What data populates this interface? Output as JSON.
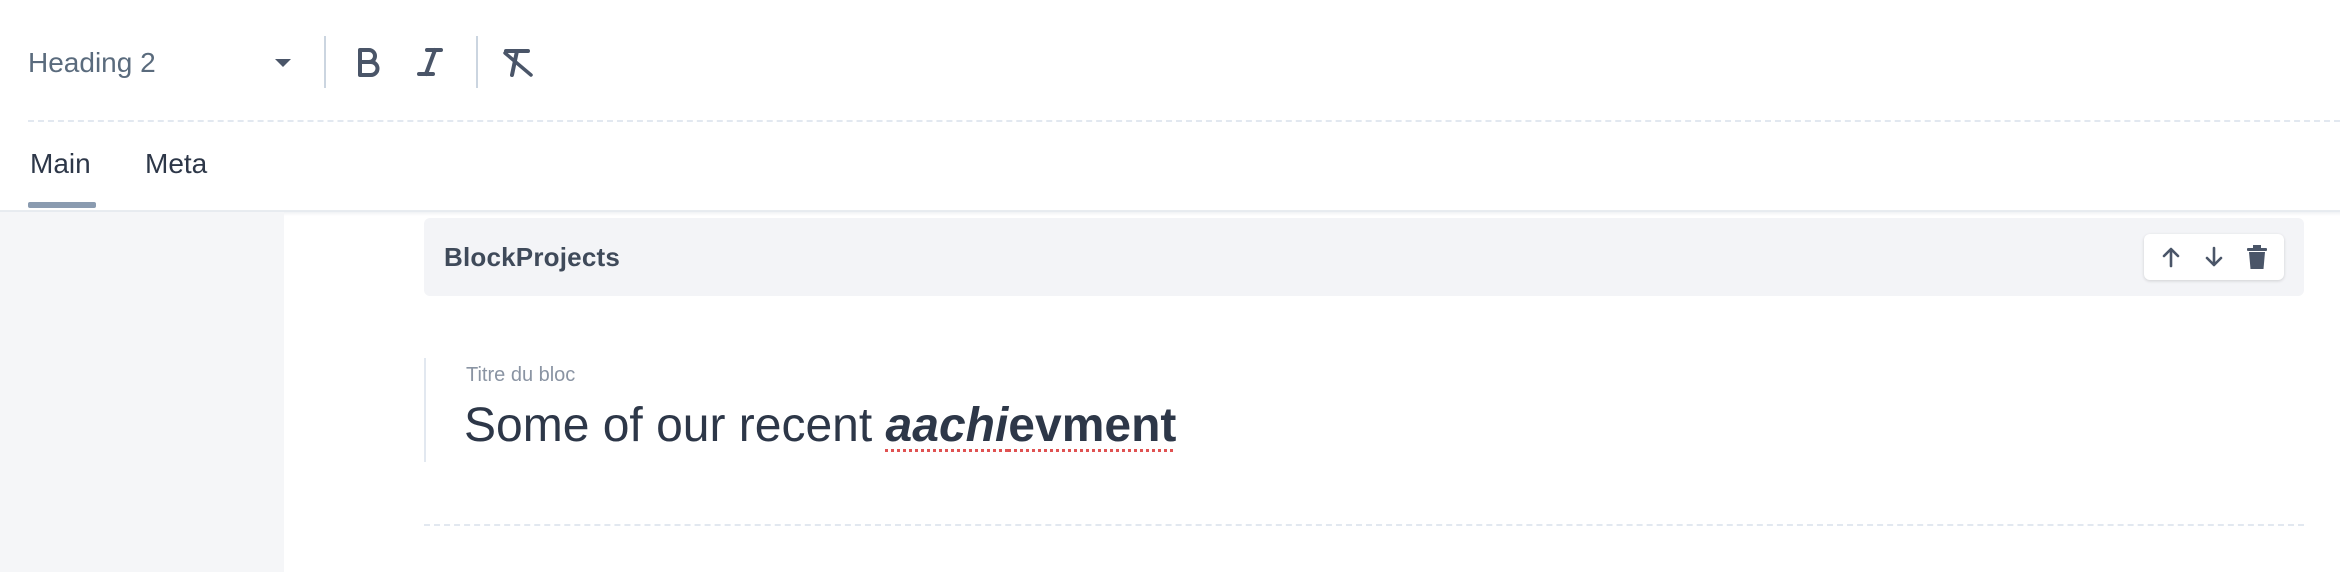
{
  "toolbar": {
    "format": "Heading 2",
    "icons": {
      "format_caret": "chevron-down-icon",
      "bold": "bold-icon",
      "italic": "italic-icon",
      "clear": "clear-format-icon"
    }
  },
  "tabs": [
    {
      "label": "Main",
      "active": true
    },
    {
      "label": "Meta",
      "active": false
    }
  ],
  "block": {
    "title": "BlockProjects",
    "actions": [
      "arrow-up-icon",
      "arrow-down-icon",
      "trash-icon"
    ]
  },
  "field": {
    "label": "Titre du bloc",
    "value_plain": "Some of our recent ",
    "value_bold_italic": "aachi",
    "value_bold": "evment"
  },
  "colors": {
    "accent_tab": "#8a9bb0",
    "spell_underline": "#e05252"
  }
}
